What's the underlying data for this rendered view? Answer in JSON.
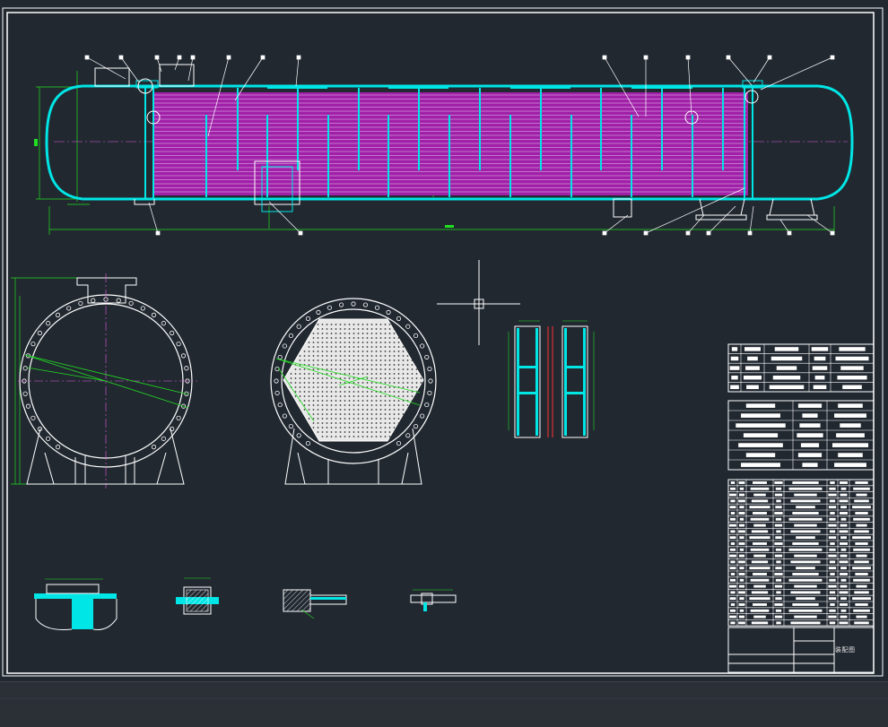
{
  "drawing": {
    "title_block_label": "装配图"
  },
  "colors": {
    "background": "#212830",
    "frame": "#ffffff",
    "shell": "#00e5e5",
    "tubes": "#c832c8",
    "tube_lines": "#e8c8f0",
    "dimension": "#22dd22",
    "centerline": "#e060e0",
    "leader": "#ffffff"
  },
  "views": [
    {
      "name": "front-elevation",
      "icon": "shell-and-tube-heat-exchanger"
    },
    {
      "name": "left-end-section",
      "icon": "shell-cross-section-with-flange-bolts"
    },
    {
      "name": "tube-sheet-section",
      "icon": "hexagonal-tube-bundle"
    },
    {
      "name": "baffle-detail",
      "icon": "baffle-plate-detail"
    },
    {
      "name": "detail-a",
      "icon": "flange-seal-detail"
    },
    {
      "name": "detail-b",
      "icon": "gasket-detail"
    },
    {
      "name": "detail-c",
      "icon": "weld-detail"
    },
    {
      "name": "detail-d",
      "icon": "bolt-detail"
    }
  ],
  "tables": [
    {
      "name": "nozzle-table",
      "rows": 5
    },
    {
      "name": "technical-characteristics-table",
      "rows": 7
    },
    {
      "name": "parts-list-table",
      "rows": 24
    }
  ],
  "cursor": {
    "icon": "crosshair-icon"
  }
}
